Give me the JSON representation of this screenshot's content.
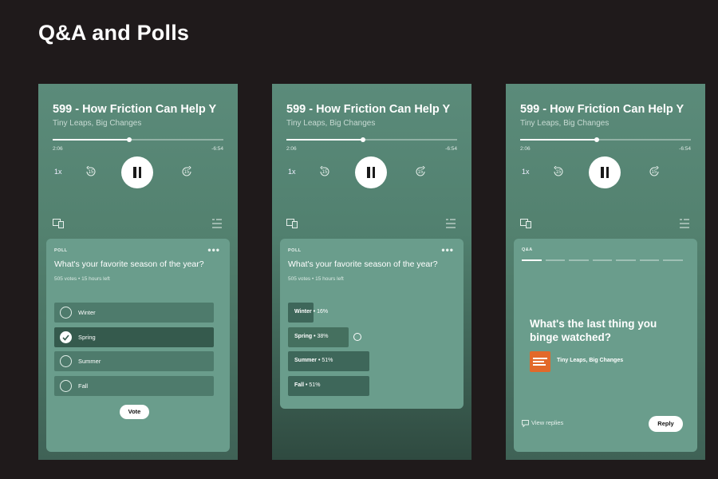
{
  "page": {
    "title": "Q&A and Polls"
  },
  "colors": {
    "background": "#1f1a1b",
    "phone_bg": "#5b8b7a",
    "card_bg": "#6a9d8c",
    "option_bg": "#4e7b6c",
    "option_selected": "#355a4d",
    "show_art": "#e2692a"
  },
  "player": {
    "episode_title": "599 - How Friction Can Help Y",
    "show_name": "Tiny Leaps, Big Changes",
    "elapsed": "2:06",
    "remaining": "-6:54",
    "progress": 0.45,
    "speed": "1x",
    "skip_back": "15",
    "skip_forward": "15",
    "icons": {
      "device": "connect-device-icon",
      "queue": "queue-icon",
      "play_pause": "pause-icon"
    }
  },
  "poll": {
    "kicker": "POLL",
    "menu": "•••",
    "question": "What's your favorite season of the year?",
    "meta": "505 votes • 15 hours left",
    "options": [
      {
        "label": "Winter",
        "selected": false
      },
      {
        "label": "Spring",
        "selected": true
      },
      {
        "label": "Summer",
        "selected": false
      },
      {
        "label": "Fall",
        "selected": false
      }
    ],
    "vote_label": "Vote"
  },
  "results": {
    "kicker": "POLL",
    "menu": "•••",
    "question": "What's your favorite season of the year?",
    "meta": "505 votes • 15 hours left",
    "items": [
      {
        "label": "Winter",
        "pct": "16%",
        "value": 16
      },
      {
        "label": "Spring",
        "pct": "38%",
        "value": 38,
        "mine": true
      },
      {
        "label": "Summer",
        "pct": "51%",
        "value": 51
      },
      {
        "label": "Fall",
        "pct": "51%",
        "value": 51
      }
    ]
  },
  "qa": {
    "kicker": "Q&A",
    "question": "What's the last thing you binge watched?",
    "show_name": "Tiny Leaps, Big Changes",
    "segments_total": 7,
    "segments_active": 1,
    "view_replies": "View replies",
    "reply_label": "Reply"
  }
}
